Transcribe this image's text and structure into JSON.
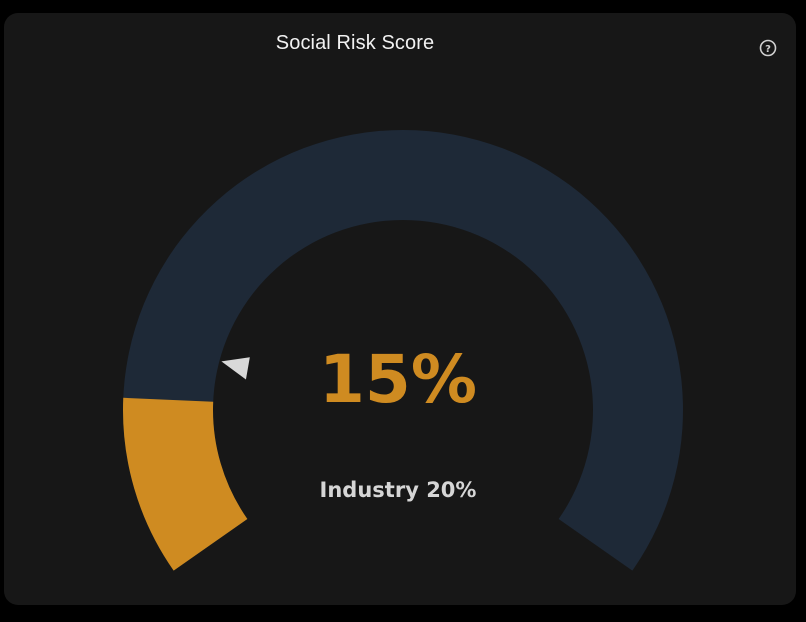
{
  "widget": {
    "title": "Social Risk Score",
    "help_icon": "help-circle-icon"
  },
  "chart_data": {
    "type": "gauge",
    "title": "Social Risk Score",
    "value": 15,
    "value_label": "15%",
    "range": [
      0,
      100
    ],
    "benchmark": 20,
    "benchmark_label": "Industry 20%",
    "colors": {
      "track": "#1e2937",
      "fill": "#cf8b21",
      "marker": "#d9d9d9",
      "background": "#171717"
    }
  }
}
